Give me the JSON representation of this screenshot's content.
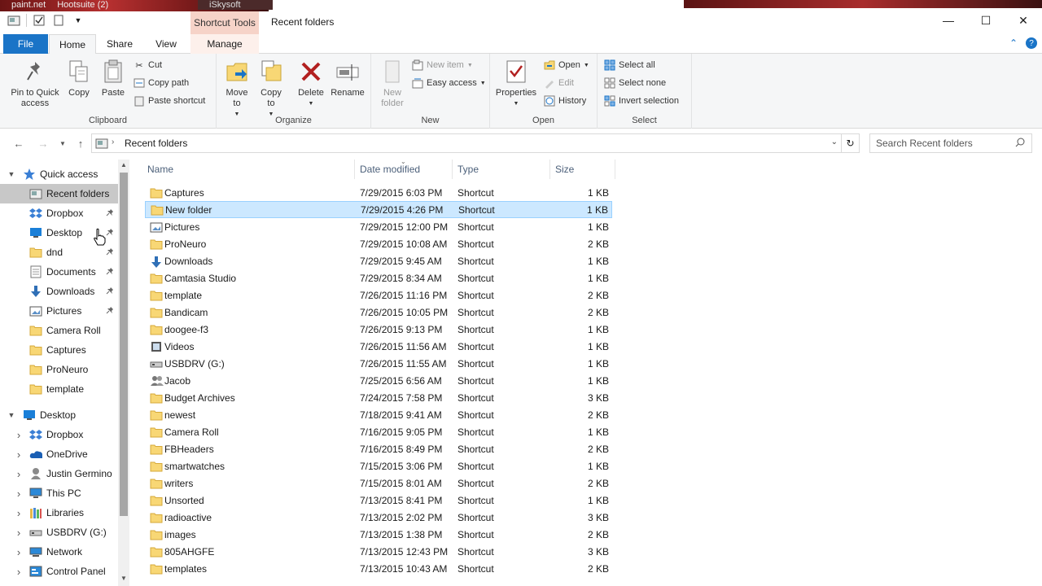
{
  "background_apps": {
    "a": "paint.net",
    "b": "Hootsuite (2)",
    "c": "iSkysoft"
  },
  "window": {
    "title": "Recent folders",
    "context_tab_header": "Shortcut Tools"
  },
  "tabs": {
    "file": "File",
    "home": "Home",
    "share": "Share",
    "view": "View",
    "manage": "Manage"
  },
  "ribbon": {
    "clipboard": {
      "label": "Clipboard",
      "pin": "Pin to Quick access",
      "copy": "Copy",
      "paste": "Paste",
      "cut": "Cut",
      "copy_path": "Copy path",
      "paste_shortcut": "Paste shortcut"
    },
    "organize": {
      "label": "Organize",
      "move_to": "Move to",
      "copy_to": "Copy to",
      "delete": "Delete",
      "rename": "Rename"
    },
    "new": {
      "label": "New",
      "new_folder": "New folder",
      "new_item": "New item",
      "easy_access": "Easy access"
    },
    "open": {
      "label": "Open",
      "properties": "Properties",
      "open": "Open",
      "edit": "Edit",
      "history": "History"
    },
    "select": {
      "label": "Select",
      "select_all": "Select all",
      "select_none": "Select none",
      "invert_selection": "Invert selection"
    }
  },
  "address": {
    "path": "Recent folders",
    "search_placeholder": "Search Recent folders"
  },
  "nav": {
    "quick_access": "Quick access",
    "items": [
      {
        "label": "Recent folders",
        "icon": "recent-folders-icon",
        "pinned": false,
        "selected": true
      },
      {
        "label": "Dropbox",
        "icon": "dropbox-icon",
        "pinned": true
      },
      {
        "label": "Desktop",
        "icon": "desktop-icon",
        "pinned": true
      },
      {
        "label": "dnd",
        "icon": "folder-icon",
        "pinned": true
      },
      {
        "label": "Documents",
        "icon": "documents-icon",
        "pinned": true
      },
      {
        "label": "Downloads",
        "icon": "downloads-icon",
        "pinned": true
      },
      {
        "label": "Pictures",
        "icon": "pictures-icon",
        "pinned": true
      },
      {
        "label": "Camera Roll",
        "icon": "folder-icon",
        "pinned": false
      },
      {
        "label": "Captures",
        "icon": "folder-icon",
        "pinned": false
      },
      {
        "label": "ProNeuro",
        "icon": "folder-icon",
        "pinned": false
      },
      {
        "label": "template",
        "icon": "folder-icon",
        "pinned": false
      }
    ],
    "desktop": "Desktop",
    "desktop_items": [
      {
        "label": "Dropbox",
        "icon": "dropbox-icon"
      },
      {
        "label": "OneDrive",
        "icon": "onedrive-icon"
      },
      {
        "label": "Justin Germino",
        "icon": "user-icon"
      },
      {
        "label": "This PC",
        "icon": "this-pc-icon"
      },
      {
        "label": "Libraries",
        "icon": "libraries-icon"
      },
      {
        "label": "USBDRV (G:)",
        "icon": "usb-drive-icon"
      },
      {
        "label": "Network",
        "icon": "network-icon"
      },
      {
        "label": "Control Panel",
        "icon": "control-panel-icon"
      }
    ]
  },
  "columns": {
    "name": "Name",
    "date": "Date modified",
    "type": "Type",
    "size": "Size"
  },
  "files": [
    {
      "name": "Captures",
      "date": "7/29/2015 6:03 PM",
      "type": "Shortcut",
      "size": "1 KB",
      "icon": "folder-icon"
    },
    {
      "name": "New folder",
      "date": "7/29/2015 4:26 PM",
      "type": "Shortcut",
      "size": "1 KB",
      "icon": "folder-icon",
      "selected": true
    },
    {
      "name": "Pictures",
      "date": "7/29/2015 12:00 PM",
      "type": "Shortcut",
      "size": "1 KB",
      "icon": "pictures-icon"
    },
    {
      "name": "ProNeuro",
      "date": "7/29/2015 10:08 AM",
      "type": "Shortcut",
      "size": "2 KB",
      "icon": "folder-icon"
    },
    {
      "name": "Downloads",
      "date": "7/29/2015 9:45 AM",
      "type": "Shortcut",
      "size": "1 KB",
      "icon": "downloads-icon"
    },
    {
      "name": "Camtasia Studio",
      "date": "7/29/2015 8:34 AM",
      "type": "Shortcut",
      "size": "1 KB",
      "icon": "folder-icon"
    },
    {
      "name": "template",
      "date": "7/26/2015 11:16 PM",
      "type": "Shortcut",
      "size": "2 KB",
      "icon": "folder-icon"
    },
    {
      "name": "Bandicam",
      "date": "7/26/2015 10:05 PM",
      "type": "Shortcut",
      "size": "2 KB",
      "icon": "folder-icon"
    },
    {
      "name": "doogee-f3",
      "date": "7/26/2015 9:13 PM",
      "type": "Shortcut",
      "size": "1 KB",
      "icon": "folder-icon"
    },
    {
      "name": "Videos",
      "date": "7/26/2015 11:56 AM",
      "type": "Shortcut",
      "size": "1 KB",
      "icon": "videos-icon"
    },
    {
      "name": "USBDRV (G:)",
      "date": "7/26/2015 11:55 AM",
      "type": "Shortcut",
      "size": "1 KB",
      "icon": "usb-drive-icon"
    },
    {
      "name": "Jacob",
      "date": "7/25/2015 6:56 AM",
      "type": "Shortcut",
      "size": "1 KB",
      "icon": "user-group-icon"
    },
    {
      "name": "Budget Archives",
      "date": "7/24/2015 7:58 PM",
      "type": "Shortcut",
      "size": "3 KB",
      "icon": "folder-icon"
    },
    {
      "name": "newest",
      "date": "7/18/2015 9:41 AM",
      "type": "Shortcut",
      "size": "2 KB",
      "icon": "folder-icon"
    },
    {
      "name": "Camera Roll",
      "date": "7/16/2015 9:05 PM",
      "type": "Shortcut",
      "size": "1 KB",
      "icon": "folder-icon"
    },
    {
      "name": "FBHeaders",
      "date": "7/16/2015 8:49 PM",
      "type": "Shortcut",
      "size": "2 KB",
      "icon": "folder-icon"
    },
    {
      "name": "smartwatches",
      "date": "7/15/2015 3:06 PM",
      "type": "Shortcut",
      "size": "1 KB",
      "icon": "folder-icon"
    },
    {
      "name": "writers",
      "date": "7/15/2015 8:01 AM",
      "type": "Shortcut",
      "size": "2 KB",
      "icon": "folder-icon"
    },
    {
      "name": "Unsorted",
      "date": "7/13/2015 8:41 PM",
      "type": "Shortcut",
      "size": "1 KB",
      "icon": "folder-icon"
    },
    {
      "name": "radioactive",
      "date": "7/13/2015 2:02 PM",
      "type": "Shortcut",
      "size": "3 KB",
      "icon": "folder-icon"
    },
    {
      "name": "images",
      "date": "7/13/2015 1:38 PM",
      "type": "Shortcut",
      "size": "2 KB",
      "icon": "folder-icon"
    },
    {
      "name": "805AHGFE",
      "date": "7/13/2015 12:43 PM",
      "type": "Shortcut",
      "size": "3 KB",
      "icon": "folder-icon"
    },
    {
      "name": "templates",
      "date": "7/13/2015 10:43 AM",
      "type": "Shortcut",
      "size": "2 KB",
      "icon": "folder-icon"
    }
  ],
  "colors": {
    "accent": "#1a74c7",
    "selection": "#cce8ff",
    "context_tab": "#f6d3c8",
    "folder": "#f8d775"
  }
}
